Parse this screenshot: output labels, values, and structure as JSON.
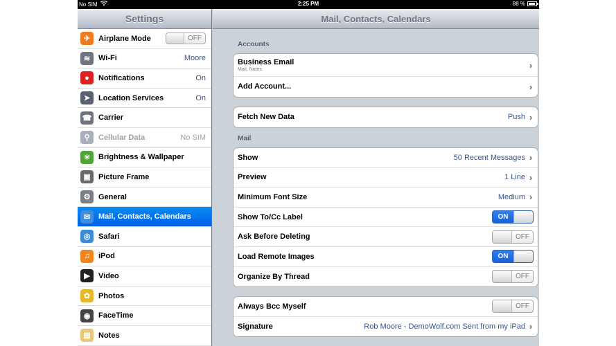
{
  "status_bar": {
    "carrier": "No SIM",
    "time": "2:25 PM",
    "battery": "88 %"
  },
  "master": {
    "title": "Settings",
    "items": [
      {
        "label": "Airplane Mode",
        "icon": "airplane-icon",
        "icon_color": "#f27a1e",
        "toggle": "OFF"
      },
      {
        "label": "Wi-Fi",
        "icon": "wifi-icon",
        "icon_color": "#6f7480",
        "value": "Moore"
      },
      {
        "label": "Notifications",
        "icon": "notifications-icon",
        "icon_color": "#d22",
        "value": "On"
      },
      {
        "label": "Location Services",
        "icon": "location-icon",
        "icon_color": "#5a6170",
        "value": "On"
      },
      {
        "label": "Carrier",
        "icon": "carrier-icon",
        "icon_color": "#6f7480"
      },
      {
        "label": "Cellular Data",
        "icon": "cellular-icon",
        "icon_color": "#a9b0bb",
        "value": "No SIM"
      },
      {
        "label": "Brightness & Wallpaper",
        "icon": "brightness-icon",
        "icon_color": "#53a33b"
      },
      {
        "label": "Picture Frame",
        "icon": "picture-frame-icon",
        "icon_color": "#6a6a6a"
      },
      {
        "label": "General",
        "icon": "gear-icon",
        "icon_color": "#7b7f88"
      },
      {
        "label": "Mail, Contacts, Calendars",
        "icon": "mail-icon",
        "icon_color": "#3f8ddf"
      },
      {
        "label": "Safari",
        "icon": "safari-icon",
        "icon_color": "#3b8bd9"
      },
      {
        "label": "iPod",
        "icon": "ipod-icon",
        "icon_color": "#f0851d"
      },
      {
        "label": "Video",
        "icon": "video-icon",
        "icon_color": "#222"
      },
      {
        "label": "Photos",
        "icon": "photos-icon",
        "icon_color": "#e6b828"
      },
      {
        "label": "FaceTime",
        "icon": "facetime-icon",
        "icon_color": "#444"
      },
      {
        "label": "Notes",
        "icon": "notes-icon",
        "icon_color": "#e8c878"
      }
    ],
    "selected_index": 9
  },
  "detail": {
    "title": "Mail, Contacts, Calendars",
    "accounts_header": "Accounts",
    "accounts": [
      {
        "label": "Business Email",
        "sub": "Mail, Notes"
      },
      {
        "label": "Add Account..."
      }
    ],
    "fetch": {
      "label": "Fetch New Data",
      "value": "Push"
    },
    "mail_header": "Mail",
    "mail": [
      {
        "label": "Show",
        "value": "50 Recent Messages"
      },
      {
        "label": "Preview",
        "value": "1 Line"
      },
      {
        "label": "Minimum Font Size",
        "value": "Medium"
      },
      {
        "label": "Show To/Cc Label",
        "toggle": "ON"
      },
      {
        "label": "Ask Before Deleting",
        "toggle": "OFF"
      },
      {
        "label": "Load Remote Images",
        "toggle": "ON"
      },
      {
        "label": "Organize By Thread",
        "toggle": "OFF"
      }
    ],
    "extra": [
      {
        "label": "Always Bcc Myself",
        "toggle": "OFF"
      },
      {
        "label": "Signature",
        "value": "Rob Moore - DemoWolf.com Sent from my iPad"
      }
    ]
  },
  "colors": {
    "selected_row": "#0a6ff0",
    "value_text": "#385487",
    "switch_on": "#2e7ef5"
  }
}
